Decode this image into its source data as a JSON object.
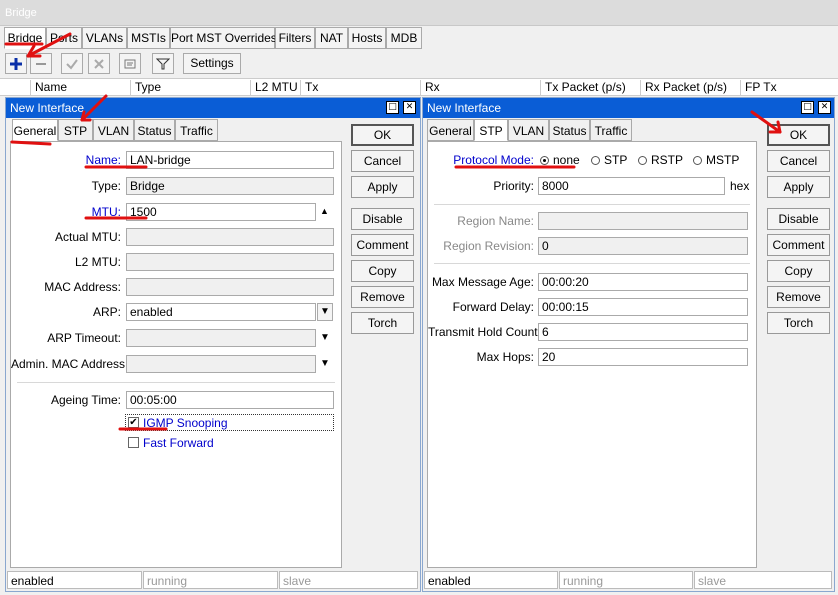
{
  "window_title": "Bridge",
  "main_tabs": [
    "Bridge",
    "Ports",
    "VLANs",
    "MSTIs",
    "Port MST Overrides",
    "Filters",
    "NAT",
    "Hosts",
    "MDB"
  ],
  "toolbar": {
    "settings_label": "Settings",
    "add_icon": "plus-icon",
    "remove_icon": "minus-icon",
    "enable_icon": "check-icon",
    "disable_icon": "x-icon",
    "comment_icon": "note-icon",
    "filter_icon": "funnel-icon"
  },
  "columns": [
    "Name",
    "Type",
    "L2 MTU",
    "Tx",
    "Rx",
    "Tx Packet (p/s)",
    "Rx Packet (p/s)",
    "FP Tx"
  ],
  "left_window": {
    "title": "New Interface",
    "tabs": [
      "General",
      "STP",
      "VLAN",
      "Status",
      "Traffic"
    ],
    "fields": {
      "name_label": "Name:",
      "name_value": "LAN-bridge",
      "type_label": "Type:",
      "type_value": "Bridge",
      "mtu_label": "MTU:",
      "mtu_value": "1500",
      "actual_mtu_label": "Actual MTU:",
      "actual_mtu_value": "",
      "l2mtu_label": "L2 MTU:",
      "l2mtu_value": "",
      "mac_label": "MAC Address:",
      "mac_value": "",
      "arp_label": "ARP:",
      "arp_value": "enabled",
      "arp_timeout_label": "ARP Timeout:",
      "arp_timeout_value": "",
      "admin_mac_label": "Admin. MAC Address:",
      "admin_mac_value": "",
      "ageing_label": "Ageing Time:",
      "ageing_value": "00:05:00",
      "igmp_label": "IGMP Snooping",
      "igmp_checked": true,
      "fast_forward_label": "Fast Forward",
      "fast_forward_checked": false
    },
    "buttons": [
      "OK",
      "Cancel",
      "Apply",
      "Disable",
      "Comment",
      "Copy",
      "Remove",
      "Torch"
    ],
    "status": [
      "enabled",
      "running",
      "slave"
    ]
  },
  "right_window": {
    "title": "New Interface",
    "tabs": [
      "General",
      "STP",
      "VLAN",
      "Status",
      "Traffic"
    ],
    "fields": {
      "protocol_label": "Protocol Mode:",
      "protocol_options": [
        "none",
        "STP",
        "RSTP",
        "MSTP"
      ],
      "protocol_selected": "none",
      "priority_label": "Priority:",
      "priority_value": "8000",
      "priority_unit": "hex",
      "region_name_label": "Region Name:",
      "region_name_value": "",
      "region_rev_label": "Region Revision:",
      "region_rev_value": "0",
      "max_age_label": "Max Message Age:",
      "max_age_value": "00:00:20",
      "fwd_delay_label": "Forward Delay:",
      "fwd_delay_value": "00:00:15",
      "hold_label": "Transmit Hold Count:",
      "hold_value": "6",
      "hops_label": "Max Hops:",
      "hops_value": "20"
    },
    "buttons": [
      "OK",
      "Cancel",
      "Apply",
      "Disable",
      "Comment",
      "Copy",
      "Remove",
      "Torch"
    ],
    "status": [
      "enabled",
      "running",
      "slave"
    ]
  },
  "colors": {
    "titlebar_active": "#0a5dd6",
    "annotation_red": "#e01010",
    "link_blue": "#0000cc"
  }
}
